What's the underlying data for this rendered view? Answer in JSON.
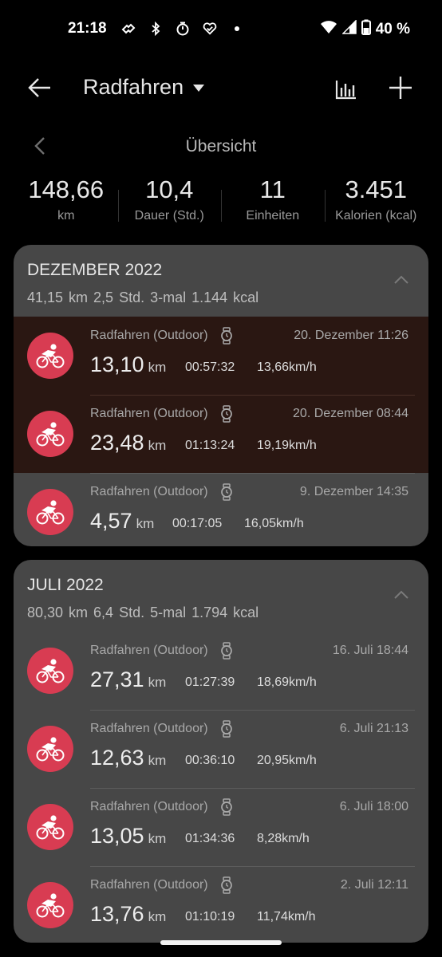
{
  "status_bar": {
    "time": "21:18",
    "battery": "40 %",
    "icons_left": [
      "signal-wave-icon",
      "bluetooth-icon",
      "stopwatch-icon",
      "heart-check-icon",
      "dot-icon"
    ],
    "icons_right": [
      "wifi-icon",
      "cell-signal-icon",
      "battery-icon"
    ]
  },
  "app_bar": {
    "title": "Radfahren",
    "icons": [
      "back-arrow-icon",
      "dropdown-caret-icon",
      "bar-chart-icon",
      "plus-icon"
    ]
  },
  "overview": {
    "title": "Übersicht",
    "stats": [
      {
        "value": "148,66",
        "label": "km"
      },
      {
        "value": "10,4",
        "label": "Dauer (Std.)"
      },
      {
        "value": "11",
        "label": "Einheiten"
      },
      {
        "value": "3.451",
        "label": "Kalorien (kcal)"
      }
    ]
  },
  "months": [
    {
      "title": "DEZEMBER 2022",
      "summary": "41,15 km  2,5 Std.  3-mal  1.144 kcal",
      "activities": [
        {
          "type": "Radfahren (Outdoor)",
          "date": "20. Dezember 11:26",
          "distance": "13,10",
          "unit": "km",
          "duration": "00:57:32",
          "speed": "13,66km/h",
          "highlight": true
        },
        {
          "type": "Radfahren (Outdoor)",
          "date": "20. Dezember 08:44",
          "distance": "23,48",
          "unit": "km",
          "duration": "01:13:24",
          "speed": "19,19km/h",
          "highlight": true
        },
        {
          "type": "Radfahren (Outdoor)",
          "date": "9. Dezember 14:35",
          "distance": "4,57",
          "unit": "km",
          "duration": "00:17:05",
          "speed": "16,05km/h",
          "highlight": false
        }
      ]
    },
    {
      "title": "JULI 2022",
      "summary": "80,30 km  6,4 Std.  5-mal  1.794 kcal",
      "activities": [
        {
          "type": "Radfahren (Outdoor)",
          "date": "16. Juli 18:44",
          "distance": "27,31",
          "unit": "km",
          "duration": "01:27:39",
          "speed": "18,69km/h",
          "highlight": false
        },
        {
          "type": "Radfahren (Outdoor)",
          "date": "6. Juli 21:13",
          "distance": "12,63",
          "unit": "km",
          "duration": "00:36:10",
          "speed": "20,95km/h",
          "highlight": false
        },
        {
          "type": "Radfahren (Outdoor)",
          "date": "6. Juli 18:00",
          "distance": "13,05",
          "unit": "km",
          "duration": "01:34:36",
          "speed": "8,28km/h",
          "highlight": false
        },
        {
          "type": "Radfahren (Outdoor)",
          "date": "2. Juli 12:11",
          "distance": "13,76",
          "unit": "km",
          "duration": "01:10:19",
          "speed": "11,74km/h",
          "highlight": false
        }
      ]
    }
  ],
  "colors": {
    "background": "#000000",
    "card": "#474747",
    "highlight_row": "#2a1712",
    "bike_badge": "#d83c52"
  }
}
